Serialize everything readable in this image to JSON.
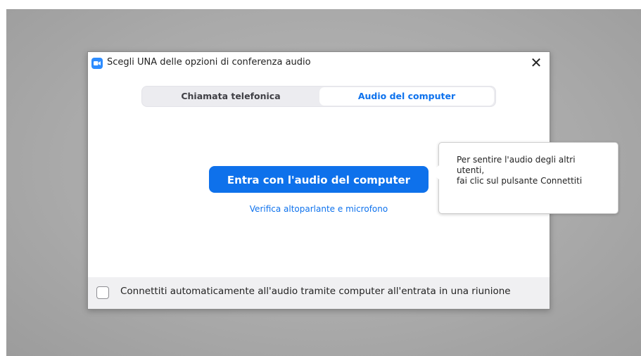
{
  "dialog": {
    "title": "Scegli UNA delle opzioni di conferenza audio",
    "close_glyph": "✕",
    "app_icon": "zoom-camera-icon"
  },
  "tabs": [
    {
      "label": "Chiamata telefonica",
      "active": false
    },
    {
      "label": "Audio del computer",
      "active": true
    }
  ],
  "main": {
    "join_button_label": "Entra con l'audio del computer",
    "test_link_label": "Verifica altoparlante e microfono"
  },
  "footer": {
    "checkbox_checked": false,
    "checkbox_label": "Connettiti automaticamente all'audio tramite computer all'entrata in una riunione"
  },
  "tooltip": {
    "line1": "Per sentire l'audio degli altri",
    "line2": "utenti,",
    "line3": "fai clic sul pulsante Connettiti"
  },
  "colors": {
    "accent": "#0e71eb",
    "backdrop": "#a9a9a9"
  }
}
